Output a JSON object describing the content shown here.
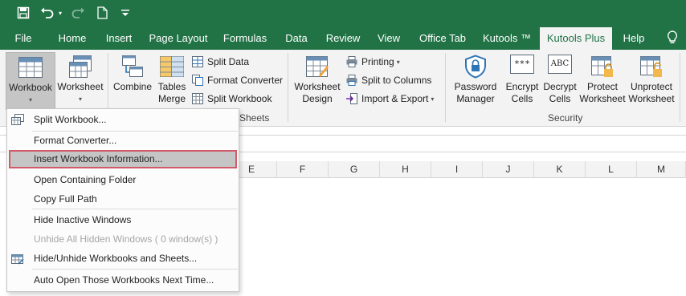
{
  "colors": {
    "brand": "#217346",
    "ribbon_bg": "#f3f3f3",
    "highlight_border": "#d05a68"
  },
  "qat": {
    "icons": [
      "save-icon",
      "undo-icon",
      "redo-icon",
      "new-document-icon",
      "customize-dropdown-icon"
    ]
  },
  "tabs": [
    {
      "label": "File"
    },
    {
      "label": "Home"
    },
    {
      "label": "Insert"
    },
    {
      "label": "Page Layout"
    },
    {
      "label": "Formulas"
    },
    {
      "label": "Data"
    },
    {
      "label": "Review"
    },
    {
      "label": "View"
    },
    {
      "label": "Office Tab"
    },
    {
      "label": "Kutools ™"
    },
    {
      "label": "Kutools Plus",
      "active": true
    },
    {
      "label": "Help"
    }
  ],
  "ribbon": {
    "workbook": {
      "label": "Workbook"
    },
    "worksheet": {
      "label": "Worksheet"
    },
    "combine": {
      "label": "Combine"
    },
    "tables_merge": {
      "line1": "Tables",
      "line2": "Merge"
    },
    "split_data": "Split Data",
    "format_converter": "Format Converter",
    "split_workbook": "Split Workbook",
    "workbook_sheets_group": "Sheets",
    "worksheet_design": {
      "line1": "Worksheet",
      "line2": "Design"
    },
    "printing": "Printing",
    "split_to_columns": "Split to Columns",
    "import_export": "Import & Export",
    "password_manager": {
      "line1": "Password",
      "line2": "Manager"
    },
    "encrypt_cells": {
      "line1": "Encrypt",
      "line2": "Cells"
    },
    "decrypt_cells": {
      "line1": "Decrypt",
      "line2": "Cells"
    },
    "protect_worksheet": {
      "line1": "Protect",
      "line2": "Worksheet"
    },
    "unprotect_worksheet": {
      "line1": "Unprotect",
      "line2": "Worksheet"
    },
    "security_group": "Security",
    "encrypt_icon_text": "***",
    "decrypt_icon_text": "ABC"
  },
  "columns": [
    "E",
    "F",
    "G",
    "H",
    "I",
    "J",
    "K",
    "L",
    "M"
  ],
  "menu": {
    "items": [
      {
        "label": "Split Workbook...",
        "icon": "split-workbook-icon"
      },
      {
        "label": "Format Converter..."
      },
      {
        "label": "Insert Workbook Information...",
        "highlighted": true
      },
      {
        "label": "Open Containing Folder"
      },
      {
        "label": "Copy Full Path"
      },
      {
        "label": "Hide Inactive Windows"
      },
      {
        "label": "Unhide All Hidden Windows ( 0 window(s) )",
        "disabled": true
      },
      {
        "label": "Hide/Unhide Workbooks and Sheets...",
        "icon": "hide-unhide-icon"
      },
      {
        "label": "Auto Open Those Workbooks Next Time..."
      }
    ]
  }
}
